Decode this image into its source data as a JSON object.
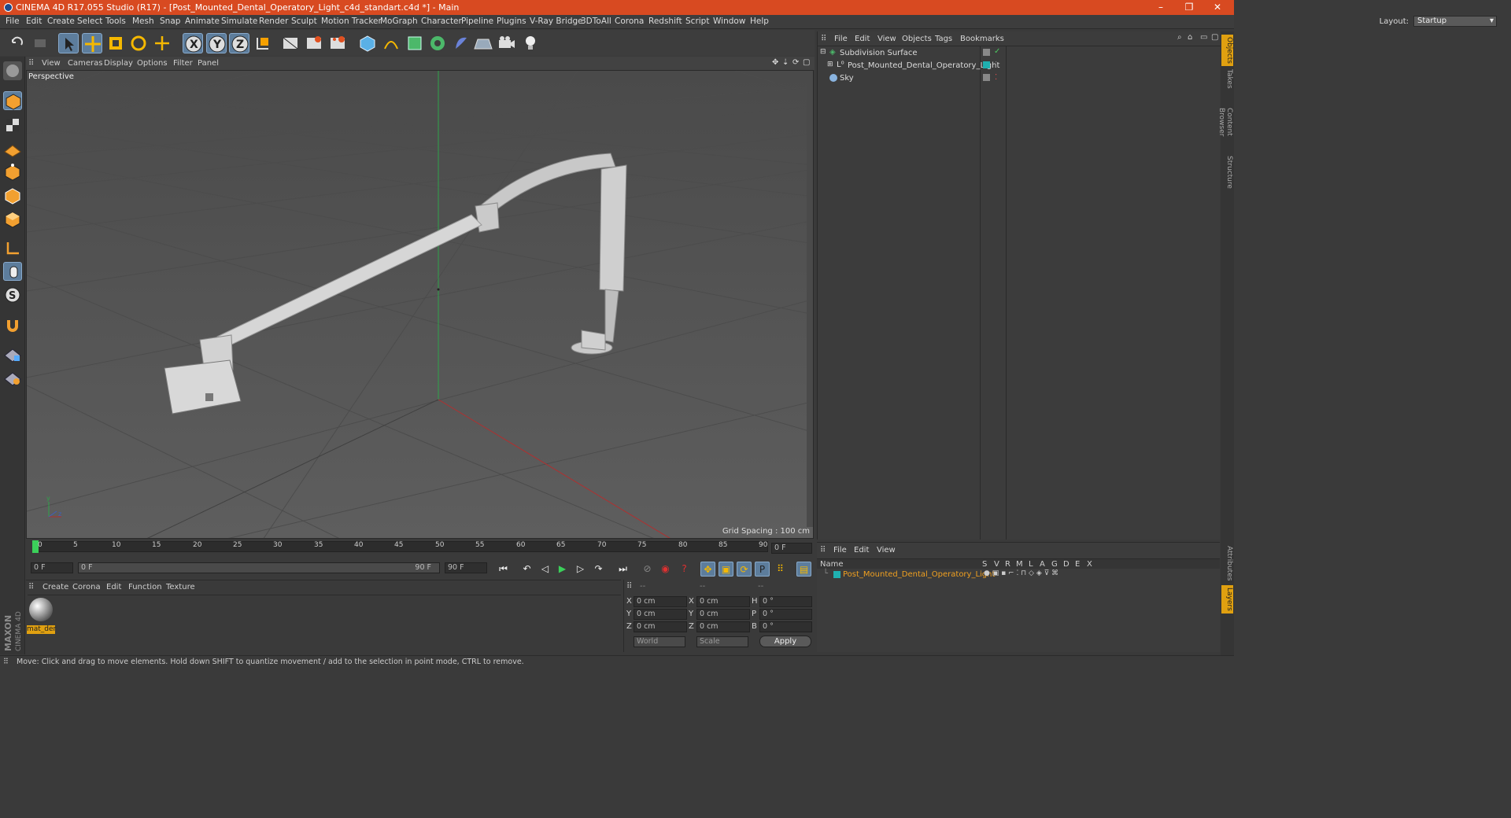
{
  "window": {
    "title": "CINEMA 4D R17.055 Studio (R17) - [Post_Mounted_Dental_Operatory_Light_c4d_standart.c4d *] - Main"
  },
  "menu": [
    "File",
    "Edit",
    "Create",
    "Select",
    "Tools",
    "Mesh",
    "Snap",
    "Animate",
    "Simulate",
    "Render",
    "Sculpt",
    "Motion Tracker",
    "MoGraph",
    "Character",
    "Pipeline",
    "Plugins",
    "V-Ray Bridge",
    "3DToAll",
    "Corona",
    "Redshift",
    "Script",
    "Window",
    "Help"
  ],
  "layout": {
    "label": "Layout:",
    "value": "Startup"
  },
  "viewport": {
    "menu": [
      "View",
      "Cameras",
      "Display",
      "Options",
      "Filter",
      "Panel"
    ],
    "label": "Perspective",
    "grid_spacing": "Grid Spacing : 100 cm"
  },
  "timeline": {
    "ticks": [
      "0",
      "5",
      "10",
      "15",
      "20",
      "25",
      "30",
      "35",
      "40",
      "45",
      "50",
      "55",
      "60",
      "65",
      "70",
      "75",
      "80",
      "85",
      "90"
    ],
    "current": "0 F",
    "start": "0 F",
    "slider_start": "0 F",
    "slider_end": "90 F",
    "end": "90 F"
  },
  "material": {
    "menu": [
      "Create",
      "Corona",
      "Edit",
      "Function",
      "Texture"
    ],
    "name": "mat_der"
  },
  "coords": {
    "headers": [
      "--",
      "--",
      "--"
    ],
    "rows": [
      {
        "a": "X",
        "av": "0 cm",
        "b": "X",
        "bv": "0 cm",
        "c": "H",
        "cv": "0 °"
      },
      {
        "a": "Y",
        "av": "0 cm",
        "b": "Y",
        "bv": "0 cm",
        "c": "P",
        "cv": "0 °"
      },
      {
        "a": "Z",
        "av": "0 cm",
        "b": "Z",
        "bv": "0 cm",
        "c": "B",
        "cv": "0 °"
      }
    ],
    "mode1": "World",
    "mode2": "Scale",
    "apply": "Apply"
  },
  "objects": {
    "menu": [
      "File",
      "Edit",
      "View",
      "Objects",
      "Tags",
      "Bookmarks"
    ],
    "items": [
      "Subdivision Surface",
      "Post_Mounted_Dental_Operatory_Light",
      "Sky"
    ]
  },
  "layers": {
    "menu": [
      "File",
      "Edit",
      "View"
    ],
    "col_name": "Name",
    "cols": [
      "S",
      "V",
      "R",
      "M",
      "L",
      "A",
      "G",
      "D",
      "E",
      "X"
    ],
    "item": "Post_Mounted_Dental_Operatory_Light"
  },
  "right_tabs": [
    "Objects",
    "Takes",
    "Content Browser",
    "Structure",
    "Attributes",
    "Layers"
  ],
  "brand": {
    "l1": "MAXON",
    "l2": "CINEMA 4D"
  },
  "status": "Move: Click and drag to move elements. Hold down SHIFT to quantize movement / add to the selection in point mode, CTRL to remove."
}
